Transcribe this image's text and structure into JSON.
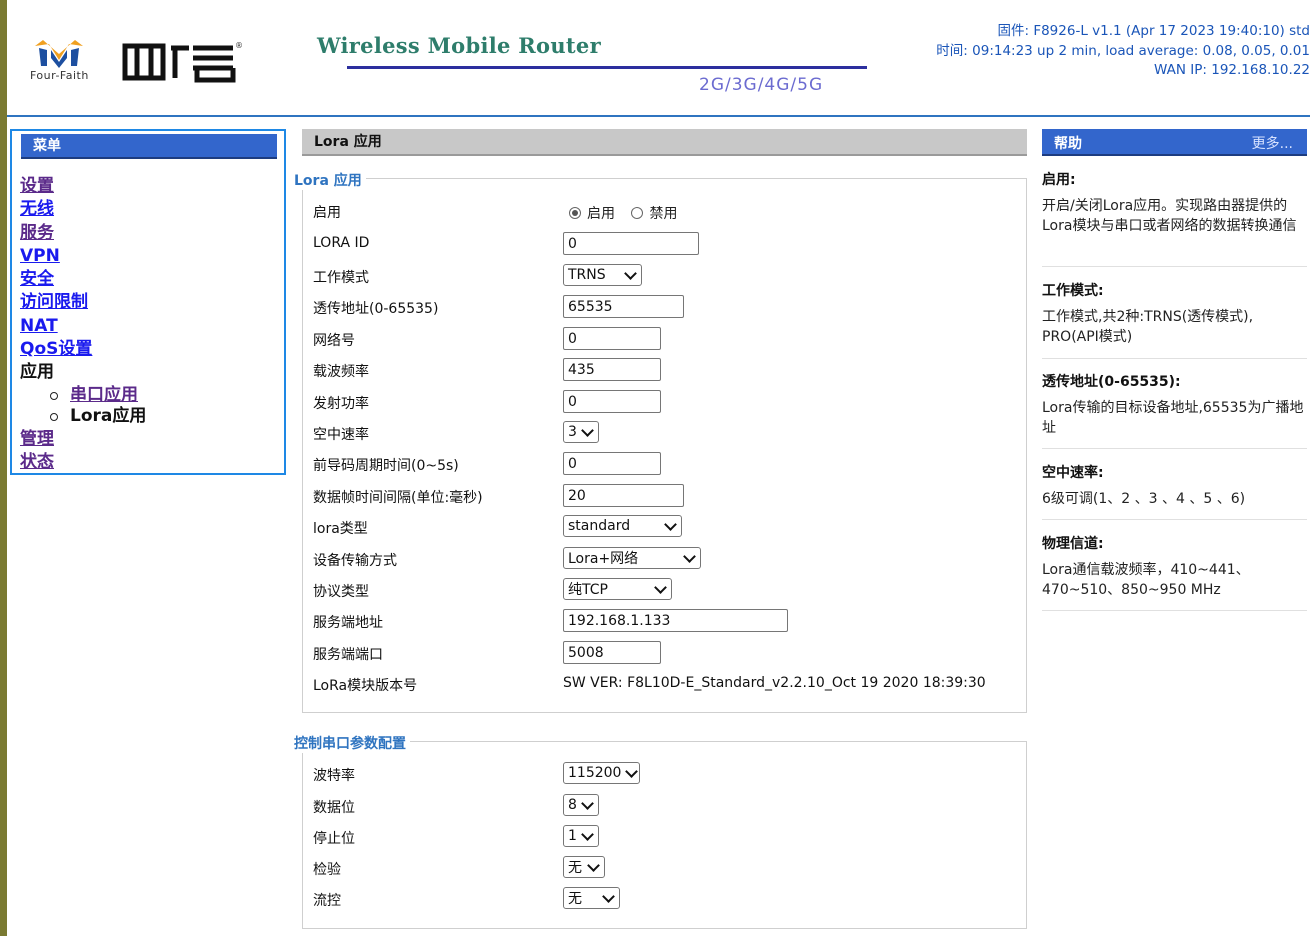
{
  "header": {
    "logo_sub": "Four-Faith",
    "product_title": "Wireless Mobile Router",
    "product_gens": "2G/3G/4G/5G",
    "firmware": "固件: F8926-L v1.1 (Apr 17 2023 19:40:10) std",
    "uptime": "时间: 09:14:23 up 2 min, load average: 0.08, 0.05, 0.01",
    "wan_ip": "WAN IP: 192.168.10.22"
  },
  "menu": {
    "title": "菜单",
    "items": [
      "设置",
      "无线",
      "服务",
      "VPN",
      "安全",
      "访问限制",
      "NAT",
      "QoS设置"
    ],
    "app_label": "应用",
    "sub_items": [
      "串口应用",
      "Lora应用"
    ],
    "bottom_items": [
      "管理",
      "状态"
    ]
  },
  "main": {
    "head": "Lora 应用",
    "lora_legend": "Lora 应用",
    "fields": {
      "enable": {
        "label": "启用",
        "opt_on": "启用",
        "opt_off": "禁用",
        "value": "启用"
      },
      "lora_id": {
        "label": "LORA ID",
        "value": "0"
      },
      "work_mode": {
        "label": "工作模式",
        "value": "TRNS"
      },
      "trans_addr": {
        "label": "透传地址(0-65535)",
        "value": "65535"
      },
      "net_id": {
        "label": "网络号",
        "value": "0"
      },
      "carrier_freq": {
        "label": "载波频率",
        "value": "435"
      },
      "tx_power": {
        "label": "发射功率",
        "value": "0"
      },
      "air_rate": {
        "label": "空中速率",
        "value": "3"
      },
      "preamble": {
        "label": "前导码周期时间(0~5s)",
        "value": "0"
      },
      "frame_interval": {
        "label": "数据帧时间间隔(单位:毫秒)",
        "value": "20"
      },
      "lora_type": {
        "label": "lora类型",
        "value": "standard"
      },
      "transfer_mode": {
        "label": "设备传输方式",
        "value": "Lora+网络"
      },
      "protocol": {
        "label": "协议类型",
        "value": "纯TCP"
      },
      "server_addr": {
        "label": "服务端地址",
        "value": "192.168.1.133"
      },
      "server_port": {
        "label": "服务端端口",
        "value": "5008"
      },
      "module_version": {
        "label": "LoRa模块版本号",
        "value": "SW VER: F8L10D-E_Standard_v2.2.10_Oct 19 2020 18:39:30"
      }
    },
    "serial_legend": "控制串口参数配置",
    "serial": {
      "baud": {
        "label": "波特率",
        "value": "115200"
      },
      "data_bits": {
        "label": "数据位",
        "value": "8"
      },
      "stop_bits": {
        "label": "停止位",
        "value": "1"
      },
      "parity": {
        "label": "检验",
        "value": "无"
      },
      "flow": {
        "label": "流控",
        "value": "无"
      }
    }
  },
  "help": {
    "title": "帮助",
    "more": "更多...",
    "sections": [
      {
        "title": "启用:",
        "body": "开启/关闭Lora应用。实现路由器提供的Lora模块与串口或者网络的数据转换通信"
      },
      {
        "title": "工作模式:",
        "body": "工作模式,共2种:TRNS(透传模式), PRO(API模式)"
      },
      {
        "title": "透传地址(0-65535):",
        "body": "Lora传输的目标设备地址,65535为广播地址"
      },
      {
        "title": "空中速率:",
        "body": "6级可调(1、2 、3 、4 、5 、6)"
      },
      {
        "title": "物理信道:",
        "body": "Lora通信载波频率，410~441、470~510、850~950 MHz"
      }
    ]
  },
  "colors": {
    "accent": "#3366cc",
    "link": "#1a1aee",
    "visited": "#5b2a8a",
    "legend": "#2f74c0"
  }
}
